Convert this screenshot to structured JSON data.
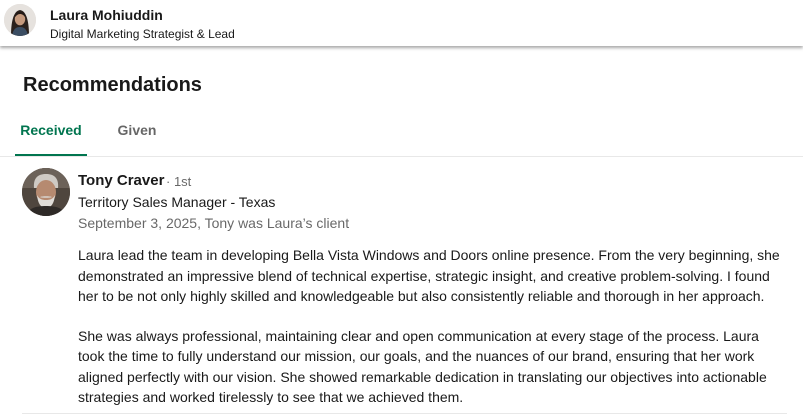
{
  "profile": {
    "name": "Laura Mohiuddin",
    "headline": "Digital Marketing Strategist & Lead"
  },
  "section": {
    "title": "Recommendations"
  },
  "tabs": [
    {
      "label": "Received",
      "active": true
    },
    {
      "label": "Given",
      "active": false
    }
  ],
  "colors": {
    "accent": "#01754f",
    "text_primary": "rgba(0,0,0,0.9)",
    "text_secondary": "rgba(0,0,0,0.6)"
  },
  "recommendations": [
    {
      "name": "Tony Craver",
      "degree": "· 1st",
      "title": "Territory Sales Manager - Texas",
      "meta": "September 3, 2025, Tony was Laura’s client",
      "paragraphs": [
        "Laura lead the team in developing Bella Vista Windows and Doors online presence. From the very beginning, she demonstrated an impressive blend of technical expertise, strategic insight, and creative problem-solving. I found her to be not only highly skilled and knowledgeable but also consistently reliable and thorough in her approach.",
        "She was always professional, maintaining clear and open communication at every stage of the process. Laura took the time to fully understand our mission, our goals, and the nuances of our brand, ensuring that her work aligned perfectly with our vision. She showed remarkable dedication in translating our objectives into actionable strategies and worked tirelessly to see that we achieved them."
      ]
    }
  ]
}
